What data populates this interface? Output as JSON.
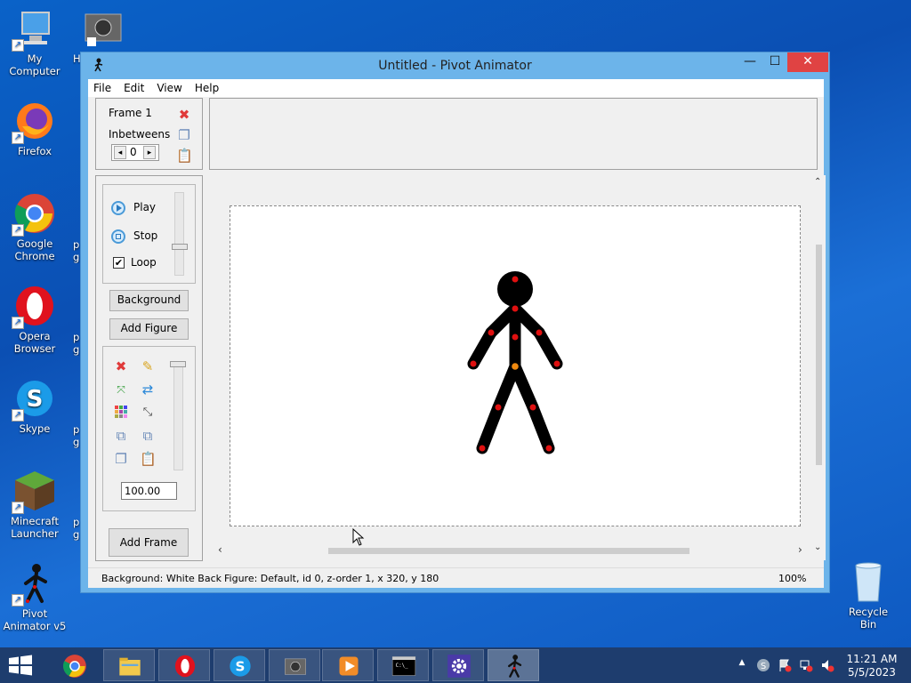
{
  "desktop": {
    "icons": [
      {
        "label": "My Computer"
      },
      {
        "label": "Firefox"
      },
      {
        "label": "Google Chrome"
      },
      {
        "label": "Opera Browser"
      },
      {
        "label": "Skype"
      },
      {
        "label": "Minecraft Launcher"
      },
      {
        "label": "Pivot Animator v5"
      }
    ],
    "clipped_label_top": "H",
    "clipped_label_p": "p",
    "clipped_label_g": "g",
    "recycle_bin": "Recycle Bin"
  },
  "window": {
    "title": "Untitled - Pivot Animator",
    "controls": {
      "minimize": "—",
      "maximize": "☐",
      "close": "✕"
    },
    "menu": [
      "File",
      "Edit",
      "View",
      "Help"
    ]
  },
  "frame_panel": {
    "frame_label": "Frame 1",
    "inbetweens_label": "Inbetweens",
    "inbetweens_value": "0",
    "left_arrow": "◂",
    "right_arrow": "▸"
  },
  "playback": {
    "play": "Play",
    "stop": "Stop",
    "loop": "Loop",
    "loop_checked": true
  },
  "buttons": {
    "background": "Background",
    "add_figure": "Add Figure",
    "add_frame": "Add Frame"
  },
  "figure_tools": {
    "scale_value": "100.00"
  },
  "statusbar": {
    "background": "Background: White Back",
    "figure": "Figure: Default,  id 0,  z-order 1,  x 320, y 180",
    "zoom": "100%"
  },
  "taskbar": {
    "time": "11:21 AM",
    "date": "5/5/2023"
  },
  "colors": {
    "accent": "#1a6fe0",
    "close_red": "#e04343",
    "joint_red": "#e01010",
    "joint_orange": "#f08a10"
  }
}
